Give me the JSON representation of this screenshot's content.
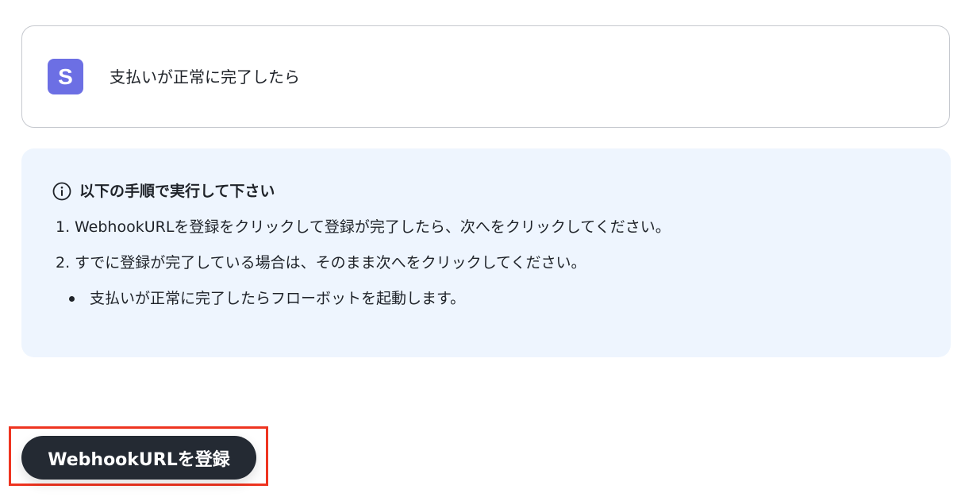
{
  "trigger": {
    "app_icon": "stripe-icon",
    "app_icon_letter": "S",
    "app_color": "#6c6fe4",
    "title": "支払いが正常に完了したら"
  },
  "instructions": {
    "heading_icon": "info-icon",
    "heading": "以下の手順で実行して下さい",
    "steps": [
      {
        "number": "1.",
        "text": "WebhookURLを登録をクリックして登録が完了したら、次へをクリックしてください。"
      },
      {
        "number": "2.",
        "text": "すでに登録が完了している場合は、そのまま次へをクリックしてください。"
      }
    ],
    "bullet": "支払いが正常に完了したらフローボットを起動します。"
  },
  "actions": {
    "register_label": "WebhookURLを登録",
    "button_color": "#242a33",
    "highlight_color": "#ee3420"
  }
}
